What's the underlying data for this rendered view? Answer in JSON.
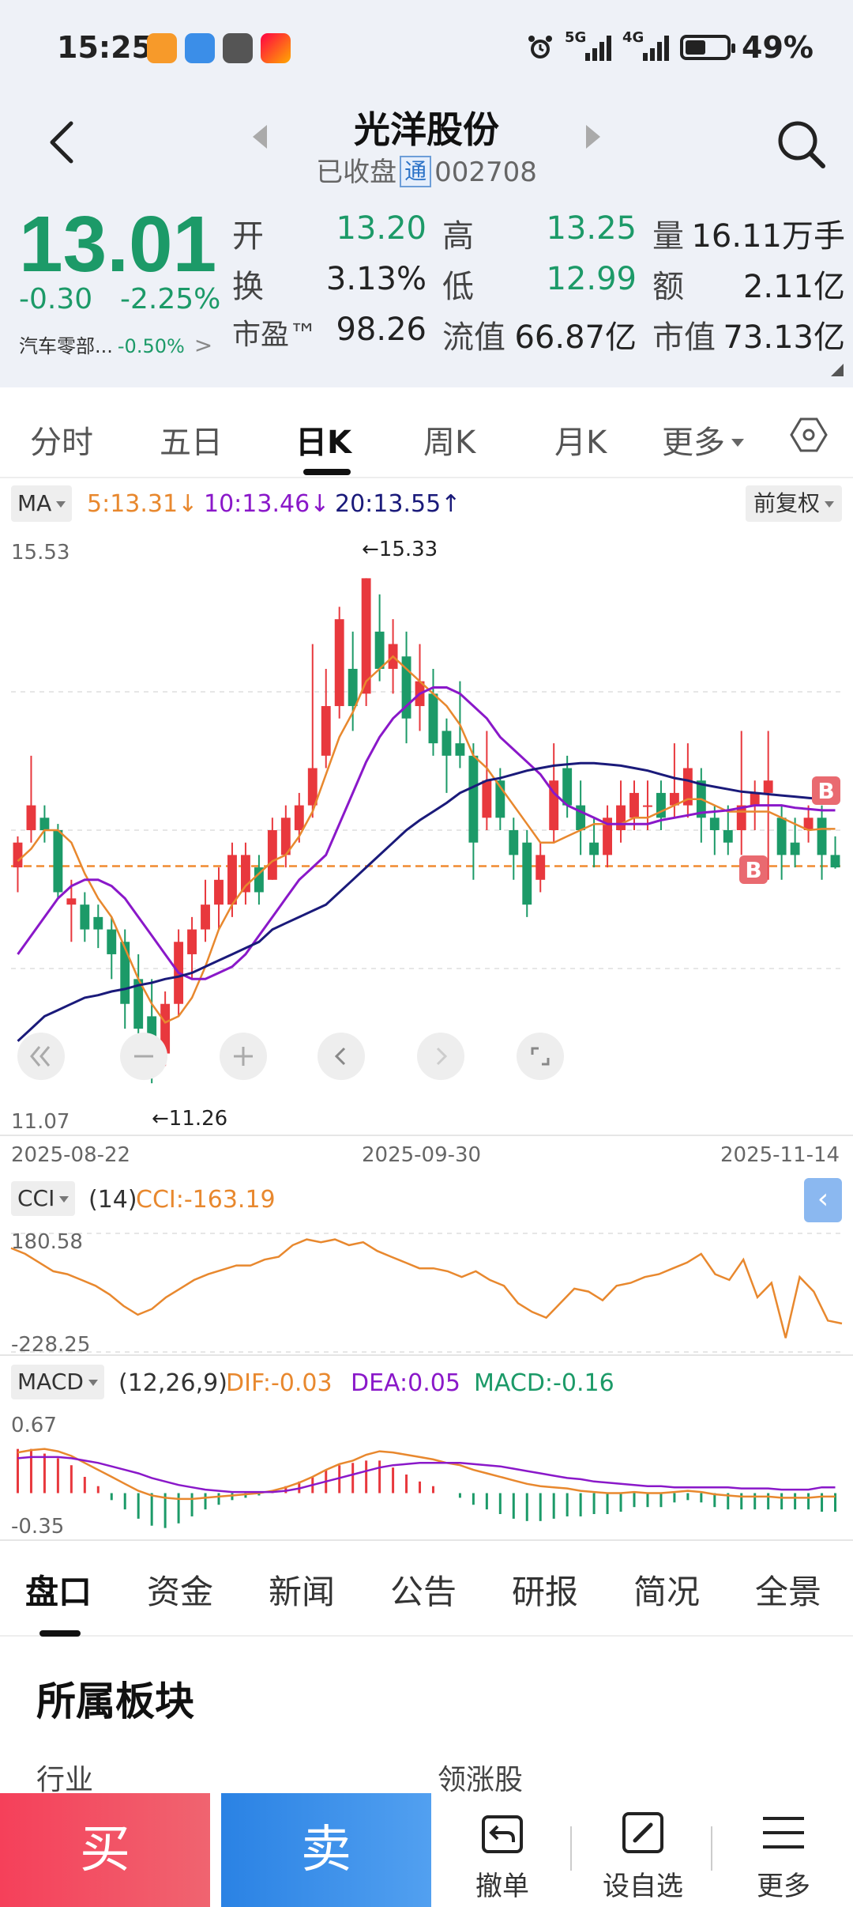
{
  "status": {
    "time": "15:25",
    "net5g": "5G",
    "net4g": "4G",
    "battery": "49%"
  },
  "header": {
    "title": "光洋股份",
    "status": "已收盘",
    "tong": "通",
    "code": "002708"
  },
  "quote": {
    "price": "13.01",
    "change": "-0.30",
    "change_pct": "-2.25%",
    "sector_name": "汽车零部...",
    "sector_change": "-0.50%",
    "fields": [
      {
        "label": "开",
        "value": "13.20"
      },
      {
        "label": "高",
        "value": "13.25"
      },
      {
        "label": "量",
        "value": "16.11万手"
      },
      {
        "label": "换",
        "value": "3.13%"
      },
      {
        "label": "低",
        "value": "12.99"
      },
      {
        "label": "额",
        "value": "2.11亿"
      },
      {
        "label": "市盈™",
        "value": "98.26"
      },
      {
        "label": "流值",
        "value": "66.87亿"
      },
      {
        "label": "市值",
        "value": "73.13亿"
      }
    ]
  },
  "tabs": [
    "分时",
    "五日",
    "日K",
    "周K",
    "月K",
    "更多"
  ],
  "ma": {
    "selector": "MA",
    "ma5": "5:13.31",
    "ma10": "10:13.46",
    "ma20": "20:13.55",
    "fq": "前复权"
  },
  "colors": {
    "up": "#e8383d",
    "down": "#1c9a68",
    "ma5": "#e8882e",
    "ma10": "#8a18c9",
    "ma20": "#1a1a7a"
  },
  "chart_data": [
    {
      "type": "candlestick",
      "y_max_label": "15.53",
      "y_min_label": "11.07",
      "ylim": [
        11.07,
        15.53
      ],
      "x_labels": [
        "2025-08-22",
        "2025-09-30",
        "2025-11-14"
      ],
      "high_mark": "←15.33",
      "low_mark": "←11.26",
      "close_line": 13.01,
      "markers": [
        "B",
        "B"
      ],
      "candles": [
        [
          13.0,
          13.2,
          12.8,
          13.25
        ],
        [
          13.3,
          13.5,
          13.2,
          13.9
        ],
        [
          13.4,
          13.3,
          13.2,
          13.5
        ],
        [
          13.3,
          12.8,
          12.75,
          13.35
        ],
        [
          12.7,
          12.75,
          12.4,
          12.9
        ],
        [
          12.7,
          12.5,
          12.4,
          12.8
        ],
        [
          12.6,
          12.5,
          12.35,
          12.7
        ],
        [
          12.5,
          12.3,
          12.1,
          12.6
        ],
        [
          12.4,
          11.9,
          11.7,
          12.5
        ],
        [
          12.1,
          11.7,
          11.5,
          12.3
        ],
        [
          11.8,
          11.5,
          11.26,
          12.1
        ],
        [
          11.5,
          11.9,
          11.4,
          12.0
        ],
        [
          11.9,
          12.4,
          11.8,
          12.5
        ],
        [
          12.3,
          12.5,
          12.1,
          12.6
        ],
        [
          12.5,
          12.7,
          12.4,
          12.9
        ],
        [
          12.7,
          12.9,
          12.5,
          13.0
        ],
        [
          12.7,
          13.1,
          12.6,
          13.2
        ],
        [
          12.8,
          13.1,
          12.7,
          13.2
        ],
        [
          13.0,
          12.8,
          12.7,
          13.1
        ],
        [
          12.9,
          13.3,
          12.9,
          13.4
        ],
        [
          13.1,
          13.4,
          13.0,
          13.5
        ],
        [
          13.3,
          13.5,
          13.2,
          13.6
        ],
        [
          13.5,
          13.8,
          13.4,
          14.8
        ],
        [
          13.9,
          14.3,
          13.8,
          14.6
        ],
        [
          14.3,
          15.0,
          14.2,
          15.1
        ],
        [
          14.6,
          14.3,
          14.1,
          14.9
        ],
        [
          14.4,
          15.33,
          14.3,
          15.33
        ],
        [
          14.9,
          14.6,
          14.5,
          15.2
        ],
        [
          14.6,
          14.8,
          14.4,
          15.0
        ],
        [
          14.7,
          14.2,
          14.0,
          14.9
        ],
        [
          14.3,
          14.5,
          14.1,
          14.8
        ],
        [
          14.4,
          14.0,
          13.9,
          14.6
        ],
        [
          14.1,
          13.9,
          13.6,
          14.2
        ],
        [
          14.0,
          13.9,
          13.8,
          14.5
        ],
        [
          13.9,
          13.2,
          12.9,
          14.0
        ],
        [
          13.4,
          13.7,
          13.3,
          14.1
        ],
        [
          13.7,
          13.4,
          13.3,
          13.8
        ],
        [
          13.3,
          13.1,
          12.9,
          13.4
        ],
        [
          13.2,
          12.7,
          12.6,
          13.3
        ],
        [
          12.9,
          13.1,
          12.8,
          13.2
        ],
        [
          13.3,
          13.7,
          13.2,
          14.0
        ],
        [
          13.8,
          13.5,
          13.4,
          13.9
        ],
        [
          13.5,
          13.3,
          13.1,
          13.7
        ],
        [
          13.2,
          13.1,
          13.0,
          13.4
        ],
        [
          13.1,
          13.4,
          13.0,
          13.5
        ],
        [
          13.3,
          13.5,
          13.2,
          13.7
        ],
        [
          13.4,
          13.6,
          13.3,
          13.7
        ],
        [
          13.5,
          13.5,
          13.3,
          13.7
        ],
        [
          13.6,
          13.4,
          13.3,
          13.7
        ],
        [
          13.5,
          13.6,
          13.4,
          14.0
        ],
        [
          13.5,
          13.8,
          13.4,
          14.0
        ],
        [
          13.7,
          13.4,
          13.2,
          13.8
        ],
        [
          13.4,
          13.3,
          13.1,
          13.5
        ],
        [
          13.3,
          13.2,
          13.1,
          13.5
        ],
        [
          13.3,
          13.5,
          13.1,
          14.1
        ],
        [
          13.5,
          13.6,
          13.3,
          13.7
        ],
        [
          13.6,
          13.7,
          12.9,
          14.1
        ],
        [
          13.4,
          13.1,
          12.9,
          13.5
        ],
        [
          13.2,
          13.1,
          13.0,
          13.4
        ],
        [
          13.3,
          13.4,
          13.2,
          13.5
        ],
        [
          13.4,
          13.1,
          12.9,
          13.5
        ],
        [
          13.1,
          13.0,
          12.99,
          13.25
        ]
      ],
      "ma5": [
        13.05,
        13.15,
        13.3,
        13.3,
        13.2,
        12.95,
        12.75,
        12.6,
        12.35,
        12.1,
        11.9,
        11.75,
        11.8,
        11.95,
        12.2,
        12.5,
        12.7,
        12.85,
        12.95,
        13.05,
        13.1,
        13.25,
        13.45,
        13.75,
        14.05,
        14.25,
        14.5,
        14.6,
        14.7,
        14.6,
        14.5,
        14.4,
        14.3,
        14.15,
        13.9,
        13.8,
        13.65,
        13.5,
        13.35,
        13.2,
        13.2,
        13.25,
        13.3,
        13.35,
        13.35,
        13.35,
        13.4,
        13.4,
        13.45,
        13.5,
        13.55,
        13.55,
        13.5,
        13.45,
        13.45,
        13.45,
        13.45,
        13.4,
        13.35,
        13.3,
        13.31,
        13.31
      ],
      "ma10": [
        12.3,
        12.45,
        12.6,
        12.75,
        12.85,
        12.9,
        12.9,
        12.85,
        12.75,
        12.6,
        12.45,
        12.3,
        12.15,
        12.1,
        12.1,
        12.15,
        12.2,
        12.3,
        12.45,
        12.6,
        12.75,
        12.9,
        13.0,
        13.1,
        13.35,
        13.6,
        13.85,
        14.05,
        14.2,
        14.3,
        14.4,
        14.45,
        14.45,
        14.4,
        14.3,
        14.2,
        14.05,
        13.95,
        13.85,
        13.75,
        13.6,
        13.5,
        13.45,
        13.4,
        13.35,
        13.35,
        13.35,
        13.35,
        13.38,
        13.4,
        13.42,
        13.44,
        13.45,
        13.46,
        13.48,
        13.5,
        13.5,
        13.5,
        13.48,
        13.47,
        13.46,
        13.46
      ],
      "ma20": [
        11.6,
        11.7,
        11.8,
        11.85,
        11.9,
        11.95,
        11.97,
        12.0,
        12.02,
        12.05,
        12.07,
        12.1,
        12.12,
        12.15,
        12.2,
        12.25,
        12.3,
        12.35,
        12.4,
        12.5,
        12.55,
        12.6,
        12.65,
        12.7,
        12.8,
        12.9,
        13.0,
        13.1,
        13.2,
        13.3,
        13.38,
        13.45,
        13.52,
        13.6,
        13.65,
        13.7,
        13.72,
        13.75,
        13.78,
        13.8,
        13.82,
        13.83,
        13.84,
        13.84,
        13.83,
        13.82,
        13.8,
        13.78,
        13.75,
        13.72,
        13.7,
        13.67,
        13.65,
        13.63,
        13.61,
        13.6,
        13.59,
        13.58,
        13.57,
        13.56,
        13.55,
        13.55
      ]
    },
    {
      "type": "line",
      "indicator": "CCI",
      "selector": "CCI",
      "param": "(14)",
      "value_text": "CCI:-163.19",
      "y_max_label": "180.58",
      "y_min_label": "-228.25",
      "ylim": [
        -228.25,
        180.58
      ],
      "values": [
        130,
        110,
        80,
        50,
        40,
        20,
        0,
        -30,
        -70,
        -100,
        -80,
        -40,
        -10,
        20,
        40,
        55,
        70,
        70,
        90,
        100,
        140,
        160,
        150,
        160,
        140,
        150,
        120,
        100,
        80,
        60,
        60,
        50,
        30,
        50,
        20,
        0,
        -60,
        -90,
        -110,
        -60,
        -10,
        -20,
        -50,
        0,
        10,
        30,
        40,
        60,
        80,
        110,
        40,
        20,
        90,
        -40,
        10,
        -180,
        30,
        -20,
        -120,
        -130
      ],
      "unit_note": ""
    },
    {
      "type": "macd",
      "indicator": "MACD",
      "selector": "MACD",
      "param": "(12,26,9)",
      "dif_text": "DIF:-0.03",
      "dea_text": "DEA:0.05",
      "macd_text": "MACD:-0.16",
      "y_max_label": "0.67",
      "y_min_label": "-0.35",
      "ylim": [
        -0.35,
        0.67
      ],
      "dif": [
        0.35,
        0.37,
        0.38,
        0.36,
        0.32,
        0.26,
        0.2,
        0.14,
        0.08,
        0.02,
        -0.02,
        -0.04,
        -0.05,
        -0.05,
        -0.04,
        -0.03,
        -0.02,
        -0.01,
        0.0,
        0.02,
        0.05,
        0.09,
        0.14,
        0.2,
        0.25,
        0.28,
        0.33,
        0.36,
        0.35,
        0.33,
        0.31,
        0.29,
        0.26,
        0.24,
        0.2,
        0.17,
        0.14,
        0.11,
        0.08,
        0.06,
        0.05,
        0.04,
        0.02,
        0.01,
        0.0,
        0.0,
        0.01,
        0.0,
        0.0,
        0.01,
        0.02,
        0.01,
        -0.01,
        -0.02,
        -0.03,
        -0.03,
        -0.03,
        -0.04,
        -0.04,
        -0.04,
        -0.03,
        -0.03
      ],
      "dea": [
        0.3,
        0.31,
        0.31,
        0.31,
        0.3,
        0.28,
        0.26,
        0.23,
        0.2,
        0.17,
        0.13,
        0.1,
        0.07,
        0.05,
        0.03,
        0.02,
        0.01,
        0.01,
        0.01,
        0.01,
        0.02,
        0.04,
        0.07,
        0.1,
        0.13,
        0.16,
        0.19,
        0.22,
        0.24,
        0.25,
        0.26,
        0.26,
        0.26,
        0.26,
        0.25,
        0.24,
        0.23,
        0.21,
        0.19,
        0.17,
        0.15,
        0.13,
        0.12,
        0.1,
        0.09,
        0.08,
        0.07,
        0.06,
        0.06,
        0.05,
        0.05,
        0.05,
        0.05,
        0.05,
        0.04,
        0.04,
        0.04,
        0.03,
        0.03,
        0.03,
        0.05,
        0.05
      ],
      "macd": [
        0.38,
        0.38,
        0.34,
        0.3,
        0.24,
        0.14,
        0.06,
        -0.06,
        -0.14,
        -0.22,
        -0.28,
        -0.3,
        -0.26,
        -0.2,
        -0.14,
        -0.1,
        -0.06,
        -0.04,
        -0.02,
        0.02,
        0.06,
        0.1,
        0.14,
        0.2,
        0.24,
        0.26,
        0.28,
        0.28,
        0.22,
        0.16,
        0.1,
        0.06,
        0.0,
        -0.04,
        -0.1,
        -0.14,
        -0.18,
        -0.22,
        -0.24,
        -0.24,
        -0.22,
        -0.2,
        -0.2,
        -0.18,
        -0.18,
        -0.16,
        -0.12,
        -0.12,
        -0.12,
        -0.08,
        -0.06,
        -0.08,
        -0.12,
        -0.14,
        -0.14,
        -0.14,
        -0.14,
        -0.14,
        -0.14,
        -0.14,
        -0.16,
        -0.16
      ]
    }
  ],
  "bottom_tabs": [
    "盘口",
    "资金",
    "新闻",
    "公告",
    "研报",
    "简况",
    "全景"
  ],
  "section": {
    "title": "所属板块",
    "col_left": "行业",
    "col_right": "领涨股"
  },
  "actions": {
    "buy": "买",
    "sell": "卖",
    "cancel": "撤单",
    "watch": "设自选",
    "more": "更多"
  },
  "icons": [
    "back-icon",
    "search-icon",
    "settings-hex-icon",
    "undo-icon",
    "edit-icon",
    "menu-icon"
  ]
}
